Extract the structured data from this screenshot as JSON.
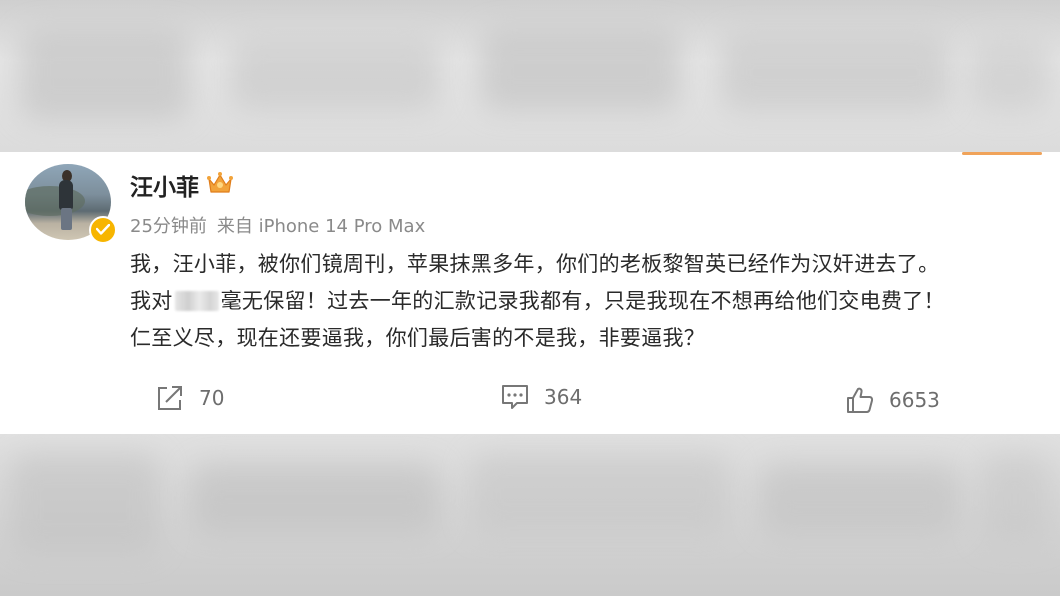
{
  "post": {
    "username": "汪小菲",
    "time_ago": "25分钟前",
    "source": "来自 iPhone 14 Pro Max",
    "text_line1": "我，汪小菲，被你们镜周刊，苹果抹黑多年，你们的老板黎智英已经作为汉奸进去了。",
    "text_line2_before": "我对",
    "text_line2_after": "毫无保留！过去一年的汇款记录我都有，只是我现在不想再给他们交电费了！",
    "text_line3": "仁至义尽，现在还要逼我，你们最后害的不是我，非要逼我？"
  },
  "actions": {
    "repost_count": "70",
    "comment_count": "364",
    "like_count": "6653"
  },
  "icons": {
    "verified": "verified-badge-icon",
    "crown": "member-crown-icon",
    "repost": "share-icon",
    "comment": "comment-icon",
    "like": "thumbs-up-icon"
  },
  "colors": {
    "verified_badge": "#f7b500",
    "crown": "#f2a33a",
    "text": "#2a2a2a",
    "meta": "#8a8a8a"
  }
}
